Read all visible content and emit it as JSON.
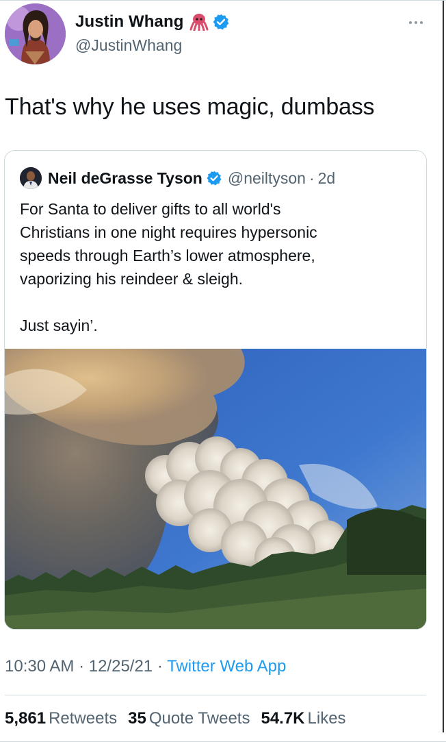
{
  "tweet": {
    "author": {
      "display_name": "Justin Whang",
      "handle": "@JustinWhang",
      "emoji": "octopus-icon",
      "verified": true
    },
    "text": "That's why he uses magic, dumbass",
    "quoted": {
      "display_name": "Neil deGrasse Tyson",
      "handle": "@neiltyson",
      "separator": "·",
      "time": "2d",
      "verified": true,
      "body_lines": [
        "For Santa to deliver gifts to all world's",
        "Christians in one night requires hypersonic",
        "speeds through Earth’s lower atmosphere,",
        "vaporizing his reindeer & sleigh."
      ],
      "body_tail": "Just sayin’.",
      "image": "wildfire-smoke-plume-photo"
    },
    "meta": {
      "time": "10:30 AM",
      "sep1": " · ",
      "date": "12/25/21",
      "sep2": " · ",
      "app": "Twitter Web App"
    },
    "stats": {
      "retweets_count": "5,861",
      "retweets_label": "Retweets",
      "quotes_count": "35",
      "quotes_label": "Quote Tweets",
      "likes_count": "54.7K",
      "likes_label": "Likes"
    }
  },
  "colors": {
    "text": "#0f1419",
    "secondary": "#536471",
    "accent": "#1d9bf0",
    "border": "#cfd9de"
  }
}
